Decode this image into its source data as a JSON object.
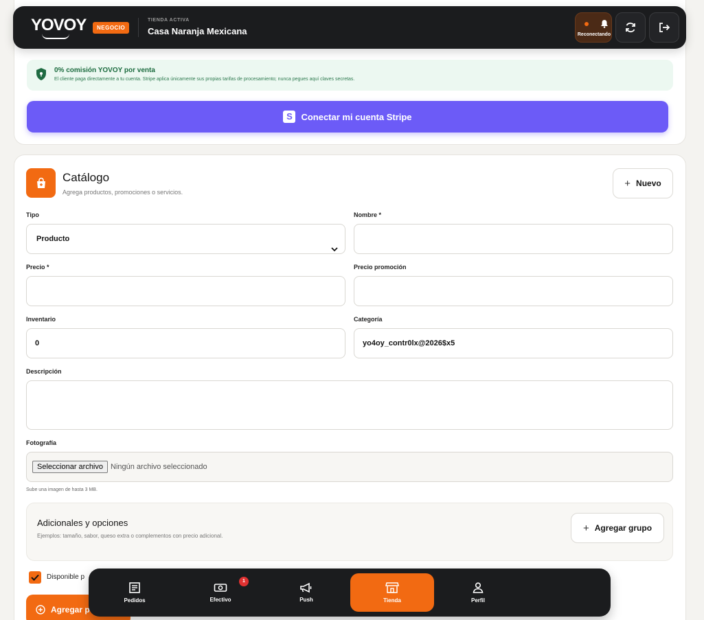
{
  "header": {
    "logo": "YOVOY",
    "business_badge": "NEGOCIO",
    "store_label": "TIENDA ACTIVA",
    "store_name": "Casa Naranja Mexicana",
    "reconnect_label": "Reconectando"
  },
  "stripe": {
    "commission_title": "0% comisión YOVOY por venta",
    "commission_text": "El cliente paga directamente a tu cuenta. Stripe aplica únicamente sus propias tarifas de procesamiento; nunca pegues aquí claves secretas.",
    "connect_button": "Conectar mi cuenta Stripe",
    "button_icon_letter": "S"
  },
  "catalog": {
    "title": "Catálogo",
    "subtitle": "Agrega productos, promociones o servicios.",
    "new_button": "Nuevo",
    "fields": {
      "type_label": "Tipo",
      "type_value": "Producto",
      "name_label": "Nombre *",
      "name_value": "",
      "price_label": "Precio *",
      "price_value": "",
      "promo_price_label": "Precio promoción",
      "promo_price_value": "",
      "inventory_label": "Inventario",
      "inventory_value": "0",
      "category_label": "Categoría",
      "category_value": "yo4oy_contr0lx@2026$x5",
      "description_label": "Descripción",
      "description_value": "",
      "photo_label": "Fotografía",
      "file_button": "Seleccionar archivo",
      "file_none": "Ningún archivo seleccionado",
      "photo_hint": "Sube una imagen de hasta 3 MB."
    },
    "addons": {
      "title": "Adicionales y opciones",
      "text": "Ejemplos: tamaño, sabor, queso extra o complementos con precio adicional.",
      "add_group_button": "Agregar grupo"
    },
    "available_label": "Disponible p",
    "available_checked": true,
    "add_product_button": "Agregar p"
  },
  "bottom_nav": {
    "items": [
      {
        "label": "Pedidos",
        "icon": "receipt-icon"
      },
      {
        "label": "Efectivo",
        "icon": "cash-icon",
        "badge": "1"
      },
      {
        "label": "Push",
        "icon": "megaphone-icon"
      },
      {
        "label": "Tienda",
        "icon": "store-icon",
        "active": true
      },
      {
        "label": "Perfil",
        "icon": "user-icon"
      }
    ]
  },
  "colors": {
    "accent": "#f26a12",
    "stripe": "#6c5bf7",
    "dark": "#1b1c1e",
    "success_bg": "#ecf8f1"
  }
}
